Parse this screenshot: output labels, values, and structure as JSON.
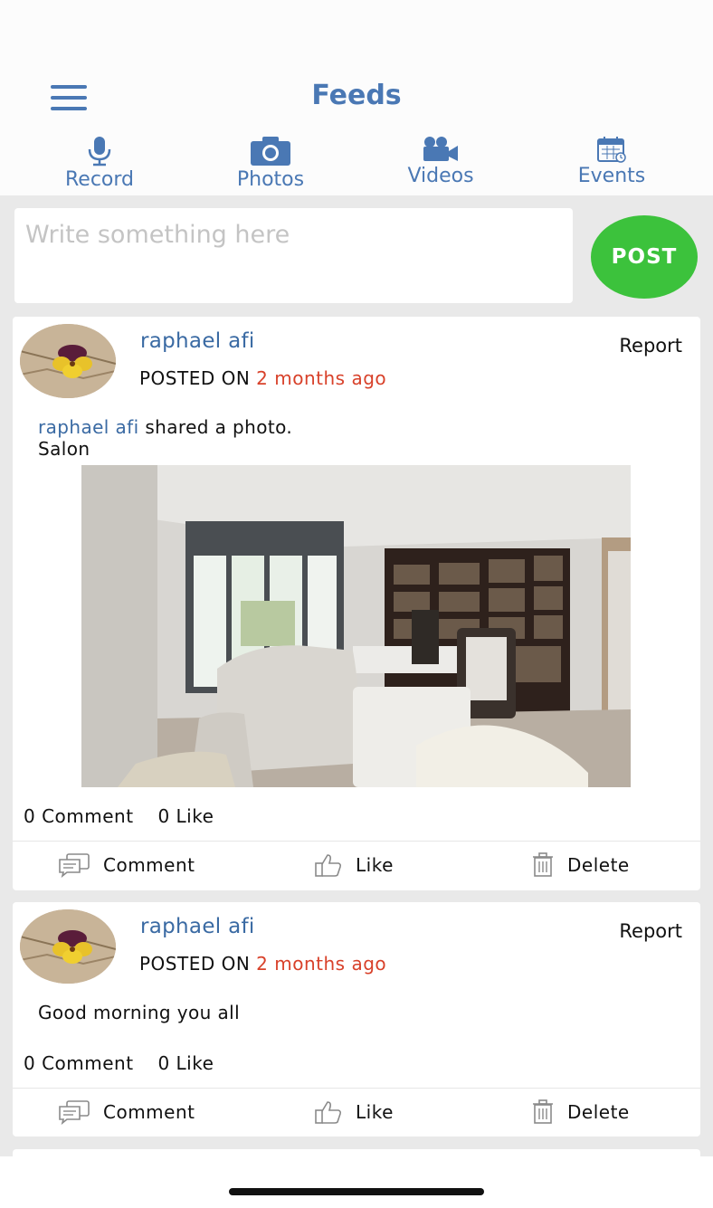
{
  "header": {
    "title": "Feeds"
  },
  "tabs": [
    {
      "label": "Record",
      "icon": "microphone-icon"
    },
    {
      "label": "Photos",
      "icon": "camera-icon"
    },
    {
      "label": "Videos",
      "icon": "video-camera-icon"
    },
    {
      "label": "Events",
      "icon": "calendar-icon"
    }
  ],
  "composer": {
    "placeholder": "Write something here",
    "value": "",
    "post_label": "POST"
  },
  "posts": [
    {
      "author": "raphael afi",
      "report_label": "Report",
      "posted_prefix": "POSTED ON",
      "time": "2 months ago",
      "share_author": "raphael afi",
      "share_text": "shared a photo.",
      "caption": "Salon",
      "comment_count": "0 Comment",
      "like_count": "0 Like",
      "actions": {
        "comment": "Comment",
        "like": "Like",
        "delete": "Delete"
      }
    },
    {
      "author": "raphael afi",
      "report_label": "Report",
      "posted_prefix": "POSTED ON",
      "time": "2 months ago",
      "text": "Good morning you all",
      "comment_count": "0 Comment",
      "like_count": "0 Like",
      "actions": {
        "comment": "Comment",
        "like": "Like",
        "delete": "Delete"
      }
    }
  ],
  "colors": {
    "accent": "#4a78b4",
    "post_button": "#3cc23c",
    "time": "#d8412a",
    "background": "#e9e9e9"
  }
}
